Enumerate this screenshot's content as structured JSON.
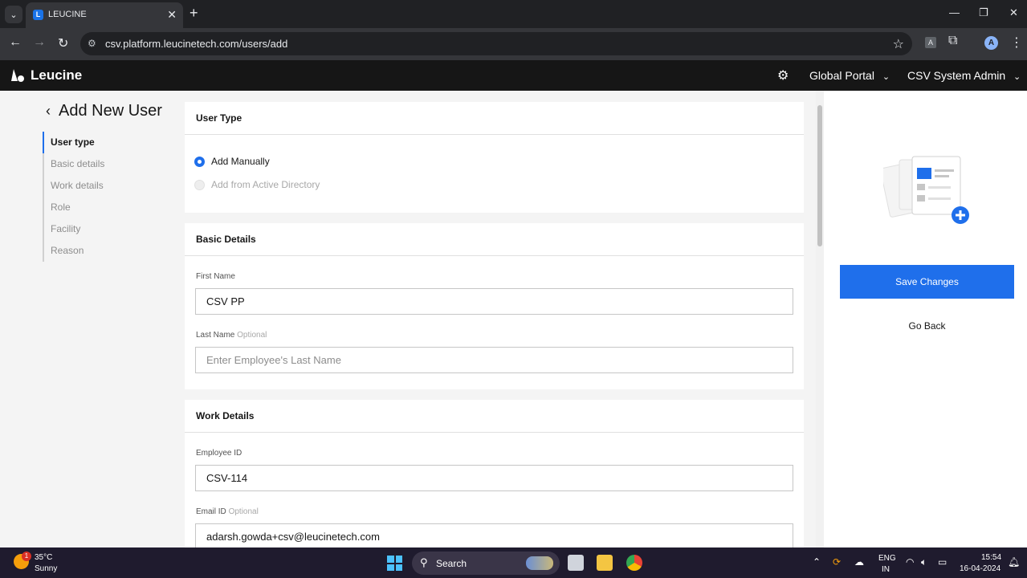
{
  "browser": {
    "tab_title": "LEUCINE",
    "url": "csv.platform.leucinetech.com/users/add",
    "profile_initial": "A",
    "extension_label": "A"
  },
  "app": {
    "logo_text": "Leucine",
    "portal_menu": "Global Portal",
    "user_menu": "CSV System Admin"
  },
  "page": {
    "title": "Add New User",
    "steps": [
      "User type",
      "Basic details",
      "Work details",
      "Role",
      "Facility",
      "Reason"
    ]
  },
  "user_type": {
    "heading": "User Type",
    "options": [
      {
        "label": "Add Manually",
        "selected": true
      },
      {
        "label": "Add from Active Directory",
        "selected": false
      }
    ]
  },
  "basic_details": {
    "heading": "Basic Details",
    "first_name_label": "First Name",
    "first_name_value": "CSV PP",
    "last_name_label": "Last Name",
    "last_name_optional": "Optional",
    "last_name_placeholder": "Enter Employee's Last Name"
  },
  "work_details": {
    "heading": "Work Details",
    "employee_id_label": "Employee ID",
    "employee_id_value": "CSV-114",
    "email_label": "Email ID",
    "email_optional": "Optional",
    "email_value": "adarsh.gowda+csv@leucinetech.com"
  },
  "actions": {
    "save": "Save Changes",
    "go_back": "Go Back"
  },
  "taskbar": {
    "weather_badge": "1",
    "temperature": "35°C",
    "condition": "Sunny",
    "search": "Search",
    "lang_1": "ENG",
    "lang_2": "IN",
    "time": "15:54",
    "date": "16-04-2024"
  },
  "colors": {
    "accent": "#1f6feb",
    "header_bg": "#161616",
    "page_bg": "#f4f4f4"
  }
}
